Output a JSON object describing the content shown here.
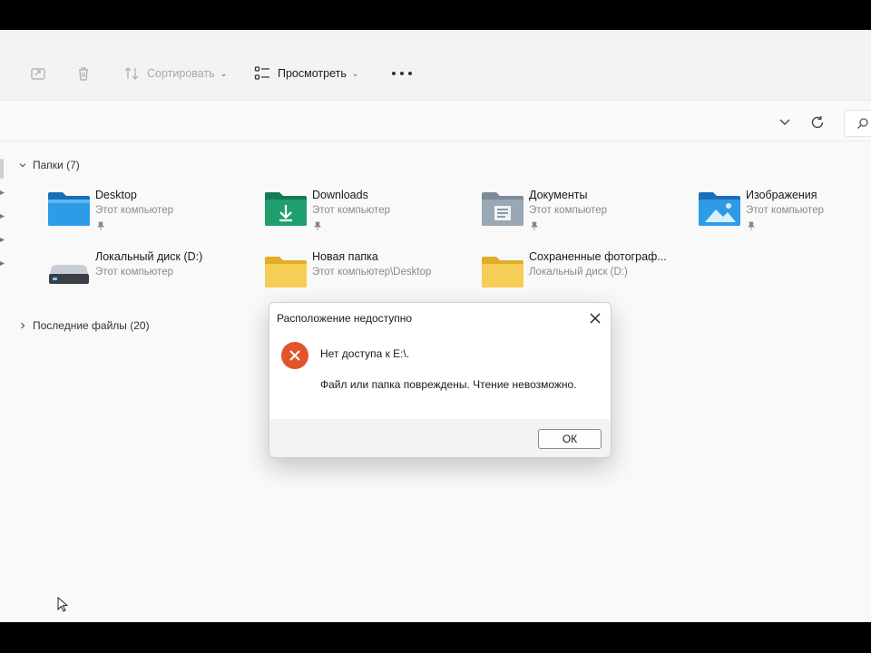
{
  "toolbar": {
    "sort_label": "Сортировать",
    "view_label": "Просмотреть"
  },
  "sections": {
    "folders_label": "Папки (7)",
    "recent_label": "Последние файлы (20)"
  },
  "tiles": [
    {
      "name": "Desktop",
      "sub": "Этот компьютер",
      "icon": "desktop-folder-icon",
      "pinned": true
    },
    {
      "name": "Downloads",
      "sub": "Этот компьютер",
      "icon": "downloads-folder-icon",
      "pinned": true
    },
    {
      "name": "Документы",
      "sub": "Этот компьютер",
      "icon": "documents-folder-icon",
      "pinned": true
    },
    {
      "name": "Изображения",
      "sub": "Этот компьютер",
      "icon": "pictures-folder-icon",
      "pinned": true
    },
    {
      "name": "Локальный диск (D:)",
      "sub": "Этот компьютер",
      "icon": "drive-icon",
      "pinned": false
    },
    {
      "name": "Новая папка",
      "sub": "Этот компьютер\\Desktop",
      "icon": "folder-icon",
      "pinned": false
    },
    {
      "name": "Сохраненные фотограф...",
      "sub": "Локальный диск (D:)",
      "icon": "folder-icon",
      "pinned": false
    }
  ],
  "dialog": {
    "title": "Расположение недоступно",
    "message": "Нет доступа к E:\\.",
    "detail": "Файл или папка повреждены. Чтение невозможно.",
    "ok_label": "ОК"
  },
  "colors": {
    "accent": "#0a7fd4",
    "error": "#e0552a",
    "downloads": "#1f9e6e",
    "folder_yellow": "#f4c542"
  }
}
